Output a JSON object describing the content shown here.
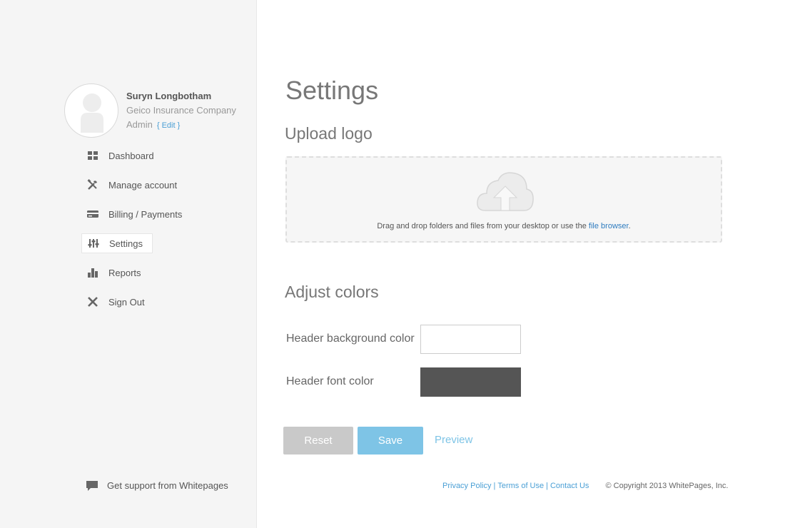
{
  "user": {
    "name": "Suryn Longbotham",
    "company": "Geico Insurance Company",
    "role": "Admin",
    "edit_label": "{ Edit }"
  },
  "nav": {
    "items": [
      {
        "label": "Dashboard",
        "icon": "dashboard-grid-icon"
      },
      {
        "label": "Manage account",
        "icon": "tools-icon"
      },
      {
        "label": "Billing / Payments",
        "icon": "credit-card-icon"
      },
      {
        "label": "Settings",
        "icon": "sliders-icon",
        "active": true
      },
      {
        "label": "Reports",
        "icon": "bar-chart-icon"
      },
      {
        "label": "Sign Out",
        "icon": "close-icon"
      }
    ]
  },
  "support": {
    "label": "Get support from Whitepages",
    "icon": "chat-bubble-icon"
  },
  "page": {
    "title": "Settings"
  },
  "upload": {
    "title": "Upload logo",
    "text": "Drag and drop folders and files from your desktop or use the ",
    "link": "file browser",
    "text_end": ".",
    "icon": "cloud-upload-icon"
  },
  "colors": {
    "title": "Adjust colors",
    "header_bg_label": "Header background color",
    "header_bg_value": "#ffffff",
    "header_font_label": "Header font color",
    "header_font_value": "#555555"
  },
  "actions": {
    "reset": "Reset",
    "save": "Save",
    "preview": "Preview"
  },
  "footer": {
    "privacy": "Privacy Policy",
    "terms": "Terms of Use",
    "contact": "Contact Us",
    "separator": "|",
    "copyright": "© Copyright 2013 WhitePages, Inc."
  },
  "theme": {
    "accent": "#4a9fd5",
    "save_button": "#7ec4e6",
    "reset_button": "#c9c9c9"
  }
}
